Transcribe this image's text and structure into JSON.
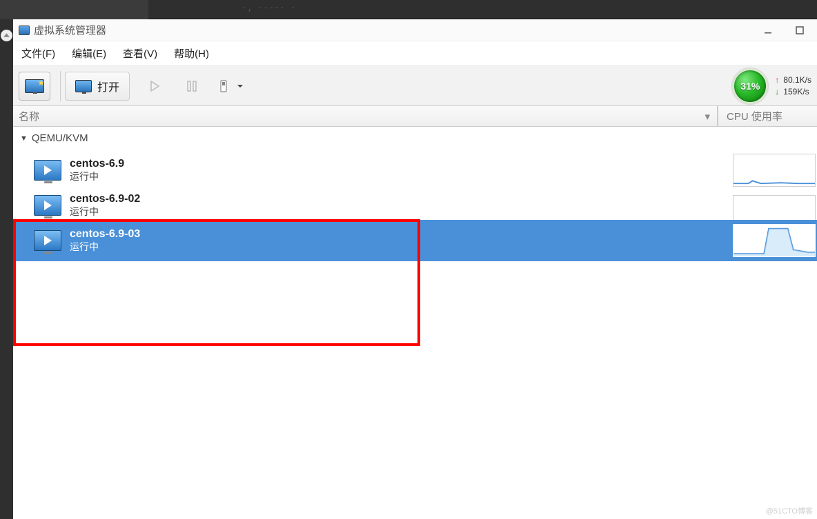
{
  "top_faint_text": "-, ----- -",
  "window": {
    "title": "虚拟系统管理器"
  },
  "menu": {
    "file": "文件(F)",
    "edit": "编辑(E)",
    "view": "查看(V)",
    "help": "帮助(H)"
  },
  "toolbar": {
    "open_label": "打开"
  },
  "gauge": {
    "value": "31%"
  },
  "net": {
    "up": "80.1K/s",
    "down": "159K/s"
  },
  "columns": {
    "name": "名称",
    "cpu": "CPU 使用率"
  },
  "connections": [
    {
      "label": "QEMU/KVM"
    }
  ],
  "vms": [
    {
      "name": "centos-6.9",
      "status": "运行中",
      "selected": false,
      "clipped": false,
      "spark": "flat"
    },
    {
      "name": "centos-6.9-02",
      "status": "运行中",
      "selected": false,
      "clipped": true,
      "spark": "flat"
    },
    {
      "name": "centos-6.9-03",
      "status": "运行中",
      "selected": true,
      "clipped": false,
      "spark": "peak"
    }
  ],
  "watermark": "@51CTO博客"
}
